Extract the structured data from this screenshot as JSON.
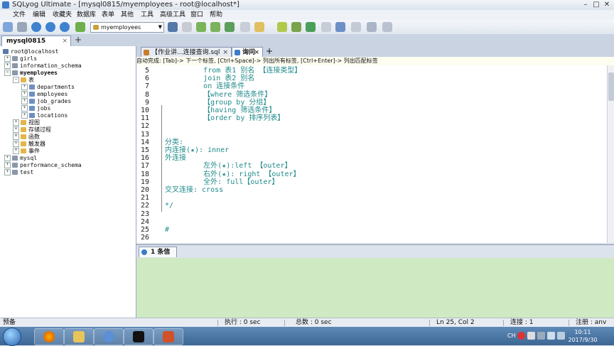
{
  "window": {
    "title": "SQLyog Ultimate - [mysql0815/myemployees - root@localhost*]",
    "min": "–",
    "max": "□",
    "close": "✕"
  },
  "menu": [
    "文件",
    "编辑",
    "收藏夹",
    "数据库",
    "表单",
    "其他",
    "工具",
    "高级工具",
    "窗口",
    "帮助"
  ],
  "toolbar": {
    "database_selected": "myemployees"
  },
  "connection_tab": {
    "label": "mysql0815",
    "close": "×",
    "add": "+"
  },
  "tree": {
    "root": "root@localhost",
    "databases": [
      "girls",
      "information_schema",
      "myemployees"
    ],
    "myemployees_children": {
      "tables_folder": "表",
      "tables": [
        "departments",
        "employees",
        "job_grades",
        "jobs",
        "locations"
      ],
      "others": [
        "视图",
        "存储过程",
        "函数",
        "触发器",
        "事件"
      ]
    },
    "other_databases": [
      "mysql",
      "performance_schema",
      "test"
    ]
  },
  "query_tabs": [
    {
      "label": "【作业讲...连接查询.sql",
      "close": "×"
    },
    {
      "label": "询问",
      "close": "×"
    }
  ],
  "query_tab_add": "+",
  "hint": "自动完成: [Tab]-> 下一个标签, [Ctrl+Space]-> 列出所有标签, [Ctrl+Enter]-> 列出匹配标签",
  "editor": {
    "lines": [
      {
        "n": "5",
        "text": "         from 表1 别名 【连接类型】"
      },
      {
        "n": "6",
        "text": "         join 表2 别名"
      },
      {
        "n": "7",
        "text": "         on 连接条件"
      },
      {
        "n": "8",
        "text": "         【where 筛选条件】"
      },
      {
        "n": "9",
        "text": "         【group by 分组】"
      },
      {
        "n": "10",
        "text": "         【having 筛选条件】"
      },
      {
        "n": "11",
        "text": "         【order by 排序列表】"
      },
      {
        "n": "12",
        "text": ""
      },
      {
        "n": "13",
        "text": ""
      },
      {
        "n": "14",
        "text": "分类:"
      },
      {
        "n": "15",
        "text": "内连接(★): inner"
      },
      {
        "n": "16",
        "text": "外连接"
      },
      {
        "n": "17",
        "text": "         左外(★):left 【outer】"
      },
      {
        "n": "18",
        "text": "         右外(★): right 【outer】"
      },
      {
        "n": "19",
        "text": "         全外: full【outer】"
      },
      {
        "n": "20",
        "text": "交叉连接: cross"
      },
      {
        "n": "21",
        "text": ""
      },
      {
        "n": "22",
        "text": "*/"
      },
      {
        "n": "23",
        "text": ""
      },
      {
        "n": "24",
        "text": ""
      },
      {
        "n": "25",
        "text": "#"
      },
      {
        "n": "26",
        "text": ""
      }
    ]
  },
  "messages": {
    "tab_label": "1 条信息"
  },
  "status": {
    "left": "预备",
    "exec": "执行 : 0 sec",
    "total": "总数 : 0 sec",
    "position": "Ln 25, Col 2",
    "connections": "连接 : 1",
    "registered": "注册 : anv"
  },
  "taskbar": {
    "lang": "CH",
    "time": "10:11",
    "date": "2017/9/30"
  },
  "colors": {
    "code": "#208a8a",
    "messages_bg": "#cfeac2",
    "taskbar": "#3c6694"
  }
}
